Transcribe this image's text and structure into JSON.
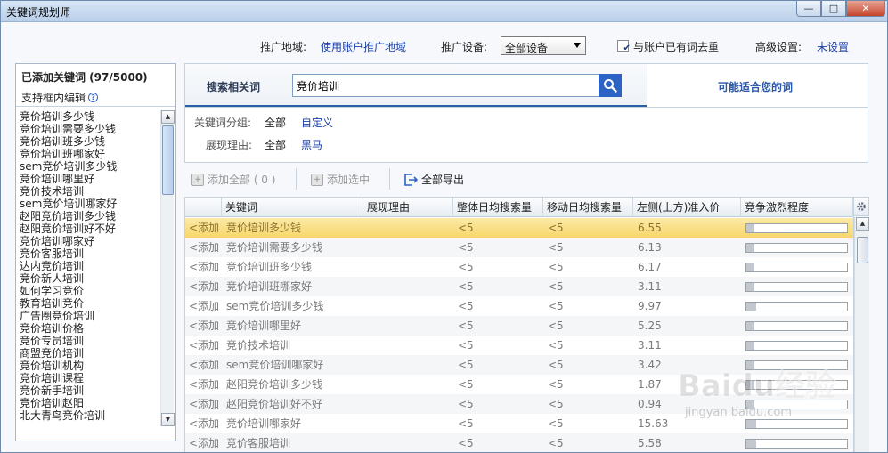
{
  "window": {
    "title": "关键词规划师",
    "min": "—",
    "max": "□",
    "close": "✕"
  },
  "settings": {
    "region_label": "推广地域:",
    "region_value": "使用账户推广地域",
    "device_label": "推广设备:",
    "device_value": "全部设备",
    "dedupe_checked": true,
    "dedupe_label": "与账户已有词去重",
    "advanced_label": "高级设置:",
    "advanced_value": "未设置"
  },
  "left_panel": {
    "title": "已添加关键词 (97/5000)",
    "subtitle": "支持框内编辑",
    "keywords": [
      "竞价培训多少钱",
      "竞价培训需要多少钱",
      "竞价培训班多少钱",
      "竞价培训班哪家好",
      "sem竞价培训多少钱",
      "竞价培训哪里好",
      "竞价技术培训",
      "sem竞价培训哪家好",
      "赵阳竞价培训多少钱",
      "赵阳竞价培训好不好",
      "竞价培训哪家好",
      "竞价客服培训",
      "达内竞价培训",
      "竞价新人培训",
      "如何学习竞价",
      "教育培训竞价",
      "广告圈竞价培训",
      "竞价培训价格",
      "竞价专员培训",
      "商盟竞价培训",
      "竞价培训机构",
      "竞价培训课程",
      "竞价新手培训",
      "竞价培训赵阳",
      "北大青鸟竞价培训"
    ]
  },
  "search": {
    "tab_label": "搜索相关词",
    "query": "竞价培训",
    "other_tab": "可能适合您的词"
  },
  "filters": {
    "group_label": "关键词分组:",
    "group_all": "全部",
    "group_custom": "自定义",
    "reason_label": "展现理由:",
    "reason_all": "全部",
    "reason_value": "黑马"
  },
  "toolbar": {
    "add_all": "添加全部 ( 0 )",
    "add_selected": "添加选中",
    "export_all": "全部导出"
  },
  "table": {
    "headers": [
      "关键词",
      "展现理由",
      "整体日均搜索量",
      "移动日均搜索量",
      "左侧(上方)准入价",
      "竞争激烈程度"
    ],
    "add_label": "<添加",
    "rows": [
      {
        "keyword": "竞价培训多少钱",
        "reason": "",
        "total": "<5",
        "mobile": "<5",
        "price": "6.55",
        "competition": 0.08
      },
      {
        "keyword": "竞价培训需要多少钱",
        "reason": "",
        "total": "<5",
        "mobile": "<5",
        "price": "6.13",
        "competition": 0.08
      },
      {
        "keyword": "竞价培训班多少钱",
        "reason": "",
        "total": "<5",
        "mobile": "<5",
        "price": "6.17",
        "competition": 0.08
      },
      {
        "keyword": "竞价培训班哪家好",
        "reason": "",
        "total": "<5",
        "mobile": "<5",
        "price": "3.11",
        "competition": 0.08
      },
      {
        "keyword": "sem竞价培训多少钱",
        "reason": "",
        "total": "<5",
        "mobile": "<5",
        "price": "9.97",
        "competition": 0.1
      },
      {
        "keyword": "竞价培训哪里好",
        "reason": "",
        "total": "<5",
        "mobile": "<5",
        "price": "5.25",
        "competition": 0.08
      },
      {
        "keyword": "竞价技术培训",
        "reason": "",
        "total": "<5",
        "mobile": "<5",
        "price": "3.11",
        "competition": 0.08
      },
      {
        "keyword": "sem竞价培训哪家好",
        "reason": "",
        "total": "<5",
        "mobile": "<5",
        "price": "3.42",
        "competition": 0.08
      },
      {
        "keyword": "赵阳竞价培训多少钱",
        "reason": "",
        "total": "<5",
        "mobile": "<5",
        "price": "1.87",
        "competition": 0.08
      },
      {
        "keyword": "赵阳竞价培训好不好",
        "reason": "",
        "total": "<5",
        "mobile": "<5",
        "price": "0.94",
        "competition": 0.08
      },
      {
        "keyword": "竞价培训哪家好",
        "reason": "",
        "total": "<5",
        "mobile": "<5",
        "price": "15.63",
        "competition": 0.1
      },
      {
        "keyword": "竞价客服培训",
        "reason": "",
        "total": "<5",
        "mobile": "<5",
        "price": "5.58",
        "competition": 0.1
      }
    ]
  },
  "watermark": {
    "brand": "Baidu经验",
    "url": "jingyan.baidu.com"
  }
}
